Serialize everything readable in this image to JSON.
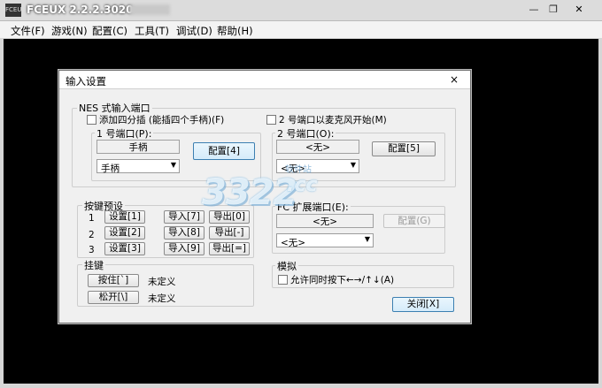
{
  "window": {
    "title": "FCEUX 2.2.2.3020",
    "icon_text": "FCEUX",
    "controls": [
      "minimize",
      "maximize",
      "close"
    ]
  },
  "menubar": {
    "items": [
      "文件(F)",
      "游戏(N)",
      "配置(C)",
      "工具(T)",
      "调试(D)",
      "帮助(H)"
    ]
  },
  "dialog": {
    "title": "输入设置",
    "close_glyph": "×",
    "nes_group": {
      "label": "NES 式输入端口",
      "four_score_label": "添加四分插 (能插四个手柄)(F)",
      "four_score_checked": false,
      "mic_label": "2 号端口以麦克风开始(M)",
      "mic_checked": false,
      "port1": {
        "label": "1 号端口(P):",
        "device": "手柄",
        "config_label": "配置[4]",
        "combo_value": "手柄"
      },
      "port2": {
        "label": "2 号端口(O):",
        "device": "<无>",
        "config_label": "配置[5]",
        "combo_value": "<无>"
      }
    },
    "presets_group": {
      "label": "按键预设",
      "rows": [
        {
          "num": "1",
          "set": "设置[1]",
          "import": "导入[7]",
          "export": "导出[0]"
        },
        {
          "num": "2",
          "set": "设置[2]",
          "import": "导入[8]",
          "export": "导出[-]"
        },
        {
          "num": "3",
          "set": "设置[3]",
          "import": "导入[9]",
          "export": "导出[=]"
        }
      ]
    },
    "fc_group": {
      "label": "FC 扩展端口(E):",
      "device": "<无>",
      "config_label": "配置(G)",
      "combo_value": "<无>"
    },
    "hotkey_group": {
      "label": "挂键",
      "hold_label": "按住[`]",
      "hold_value": "未定义",
      "release_label": "松开[\\]",
      "release_value": "未定义"
    },
    "emu_group": {
      "label": "模拟",
      "allow_label": "允许同时按下←→/↑↓(A)",
      "allow_checked": false
    },
    "close_button": "关闭[X]"
  },
  "watermark": {
    "digits": "3322",
    "suffix": ".cc",
    "cn_text": "软件站"
  }
}
